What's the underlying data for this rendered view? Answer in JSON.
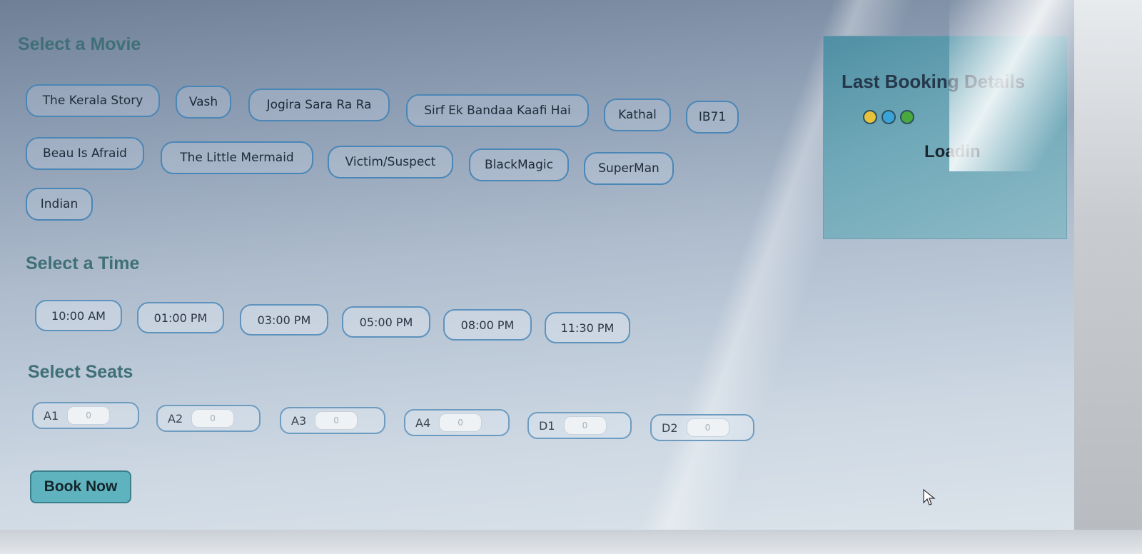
{
  "movie_section": {
    "title": "Select a Movie",
    "movies": [
      "The Kerala Story",
      "Vash",
      "Jogira Sara Ra Ra",
      "Sirf Ek Bandaa Kaafi Hai",
      "Kathal",
      "IB71",
      "Beau Is Afraid",
      "The Little Mermaid",
      "Victim/Suspect",
      "BlackMagic",
      "SuperMan",
      "Indian"
    ]
  },
  "time_section": {
    "title": "Select a Time",
    "times": [
      "10:00 AM",
      "01:00 PM",
      "03:00 PM",
      "05:00 PM",
      "08:00 PM",
      "11:30 PM"
    ]
  },
  "seat_section": {
    "title": "Select Seats",
    "seats": [
      {
        "label": "A1",
        "value": "0"
      },
      {
        "label": "A2",
        "value": "0"
      },
      {
        "label": "A3",
        "value": "0"
      },
      {
        "label": "A4",
        "value": "0"
      },
      {
        "label": "D1",
        "value": "0"
      },
      {
        "label": "D2",
        "value": "0"
      }
    ]
  },
  "book_button": {
    "label": "Book Now"
  },
  "last_booking": {
    "title": "Last Booking Details",
    "status": "Loadin",
    "dot_colors": [
      "#e8c23a",
      "#3aa3d8",
      "#49a93e"
    ]
  }
}
